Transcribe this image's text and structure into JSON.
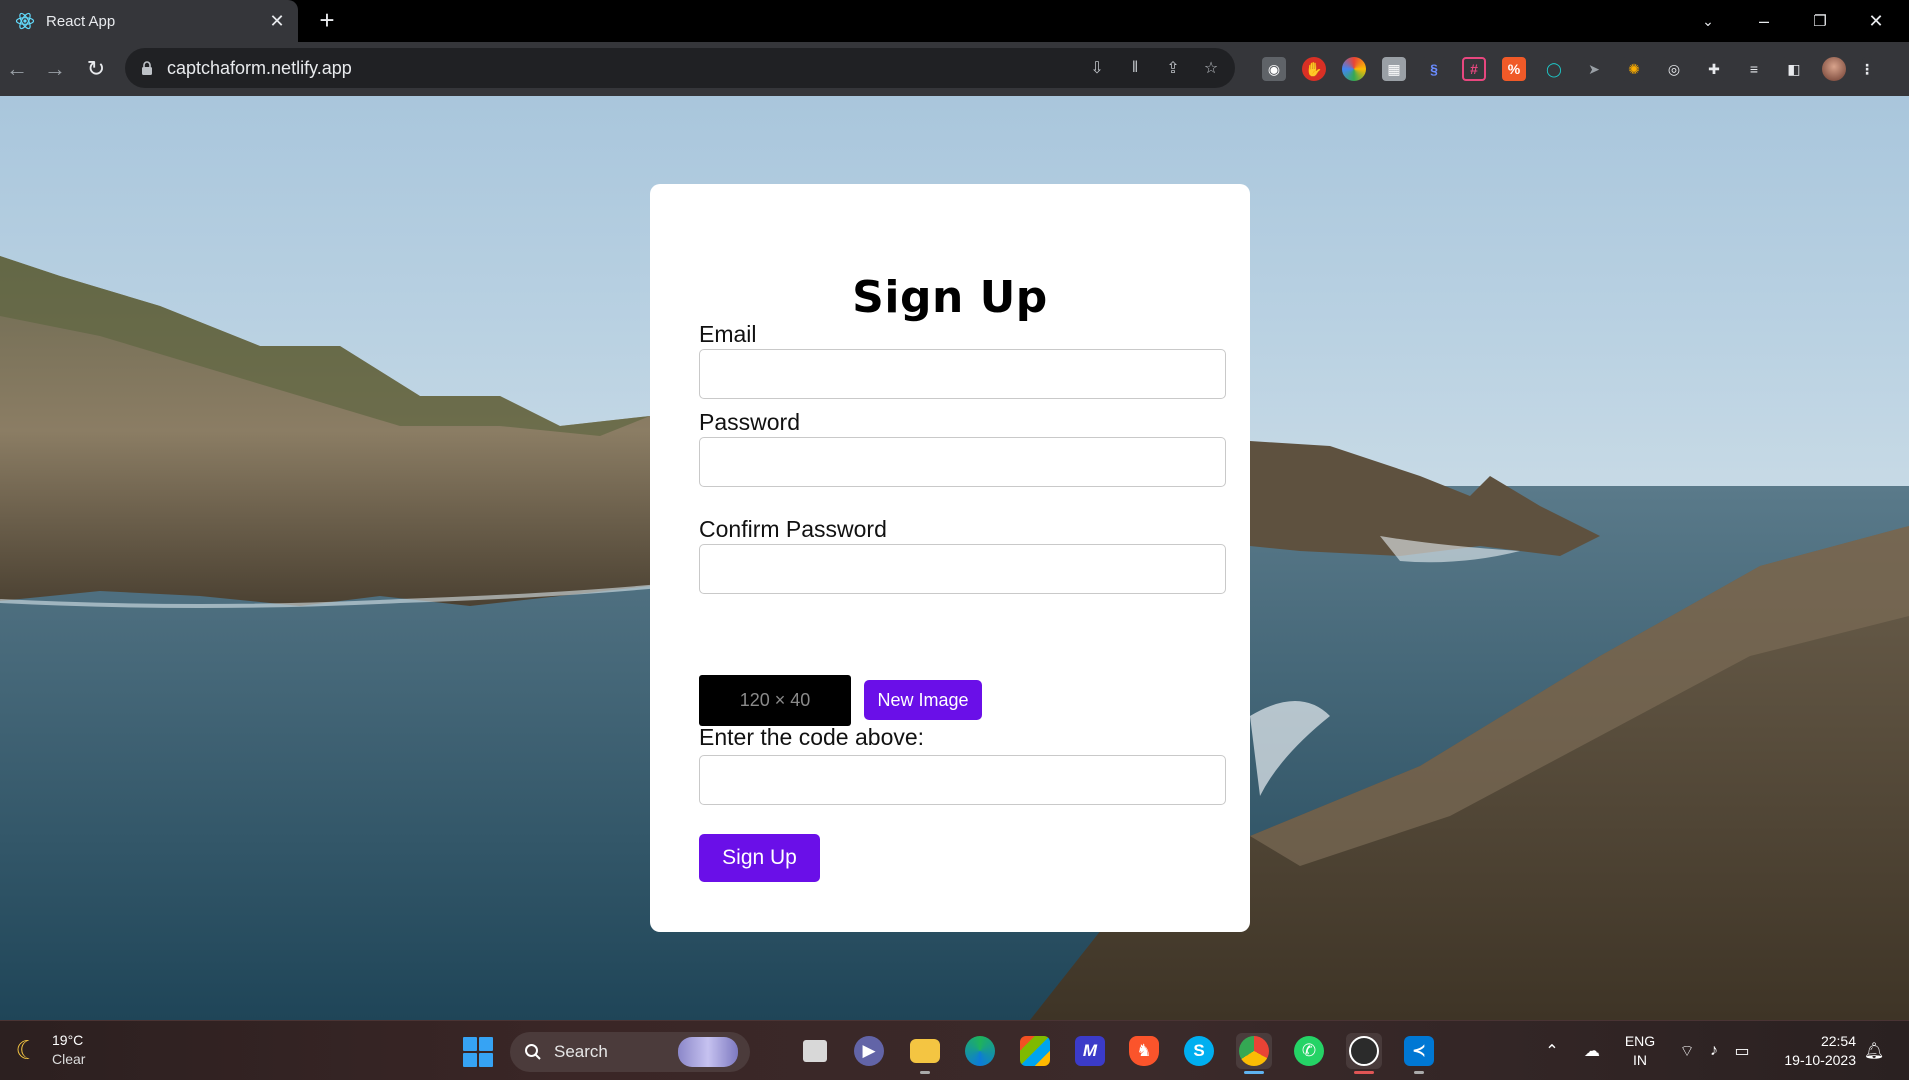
{
  "browser": {
    "tab_title": "React App",
    "url": "captchaform.netlify.app",
    "icons": {
      "favicon": "react-icon",
      "close": "close-icon",
      "new_tab": "plus-icon",
      "lock": "lock-icon"
    }
  },
  "form": {
    "title": "Sign Up",
    "email_label": "Email",
    "email_value": "",
    "password_label": "Password",
    "password_value": "",
    "confirm_label": "Confirm Password",
    "confirm_value": "",
    "captcha_placeholder": "120 × 40",
    "new_image_label": "New Image",
    "code_label": "Enter the code above:",
    "code_value": "",
    "submit_label": "Sign Up",
    "accent_color": "#6a0fe8"
  },
  "taskbar": {
    "weather_temp": "19°C",
    "weather_cond": "Clear",
    "search_label": "Search",
    "lang_line1": "ENG",
    "lang_line2": "IN",
    "time": "22:54",
    "date": "19-10-2023"
  }
}
